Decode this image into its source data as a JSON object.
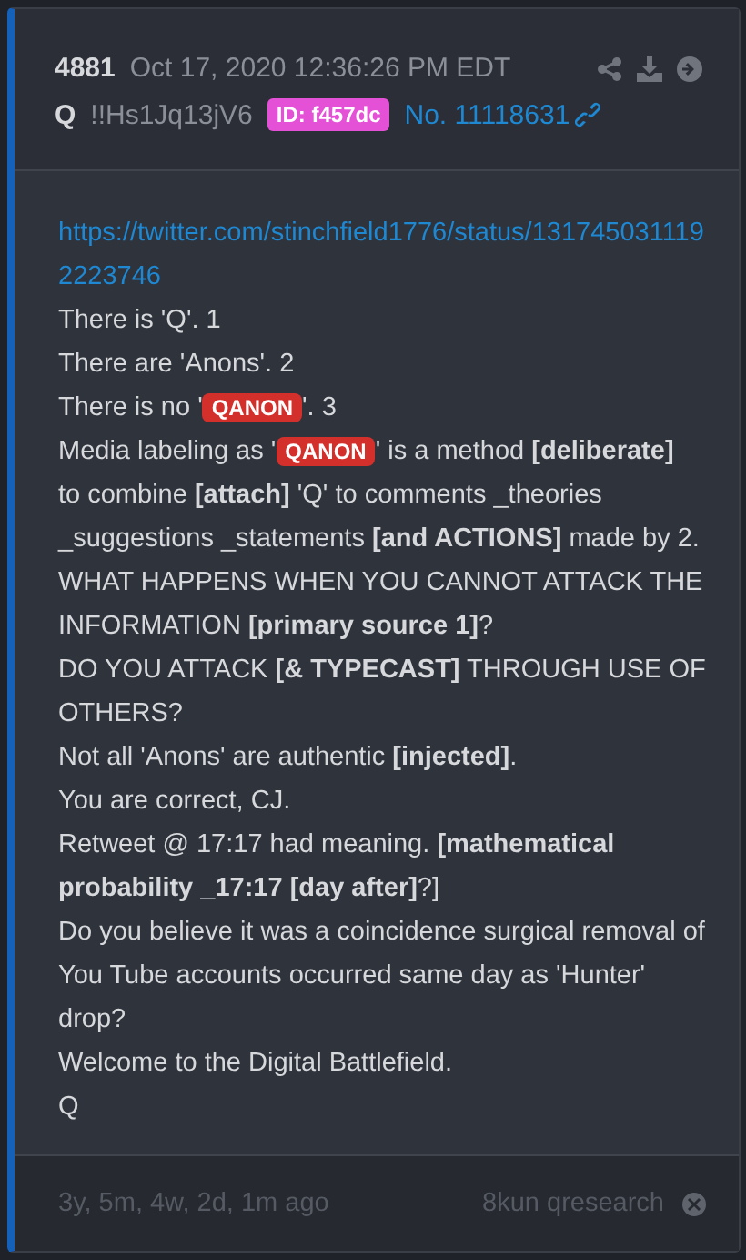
{
  "header": {
    "number": "4881",
    "date": "Oct 17, 2020 12:36:26 PM EDT",
    "author": "Q",
    "tripcode": "!!Hs1Jq13jV6",
    "id_badge": "ID: f457dc",
    "post_link": "No. 11118631"
  },
  "body": {
    "link": "https://twitter.com/stinchfield1776/status/1317450311192223746",
    "lines": [
      {
        "parts": [
          {
            "kind": "text",
            "text": "There is 'Q'. 1"
          }
        ]
      },
      {
        "parts": [
          {
            "kind": "text",
            "text": "There are 'Anons'. 2"
          }
        ]
      },
      {
        "parts": [
          {
            "kind": "text",
            "text": "There is no '"
          },
          {
            "kind": "tag",
            "text": "QANON"
          },
          {
            "kind": "text",
            "text": "'. 3"
          }
        ]
      },
      {
        "parts": [
          {
            "kind": "text",
            "text": "Media labeling as '"
          },
          {
            "kind": "tag",
            "text": "QANON"
          },
          {
            "kind": "text",
            "text": "' is a method **[deliberate]**"
          },
          {
            "kind": "continuation",
            "text": "to combine **[attach]** 'Q' to comments _theories _suggestions _statements **[and ACTIONS]** made by 2."
          }
        ]
      },
      {
        "parts": [
          {
            "kind": "text",
            "text": "WHAT HAPPENS WHEN YOU CANNOT ATTACK THE INFORMATION **[primary source 1]**?"
          }
        ]
      },
      {
        "parts": [
          {
            "kind": "text",
            "text": "DO YOU ATTACK **[& TYPECAST]** THROUGH USE OF OTHERS?"
          }
        ]
      },
      {
        "parts": [
          {
            "kind": "text",
            "text": "Not all 'Anons' are authentic **[injected]**."
          }
        ]
      },
      {
        "parts": [
          {
            "kind": "text",
            "text": "You are correct, CJ."
          }
        ]
      },
      {
        "parts": [
          {
            "kind": "text",
            "text": "Retweet @ 17:17 had meaning. **[mathematical probability _17:17 [day after]**?]"
          }
        ]
      },
      {
        "parts": [
          {
            "kind": "text",
            "text": "Do you believe it was a coincidence surgical removal of You Tube accounts occurred same day as 'Hunter' drop?"
          }
        ]
      },
      {
        "parts": [
          {
            "kind": "text",
            "text": "Welcome to the Digital Battlefield."
          }
        ]
      },
      {
        "parts": [
          {
            "kind": "text",
            "text": "Q"
          }
        ]
      }
    ]
  },
  "footer": {
    "age": "3y, 5m, 4w, 2d, 1m ago",
    "source": "8kun qresearch"
  }
}
